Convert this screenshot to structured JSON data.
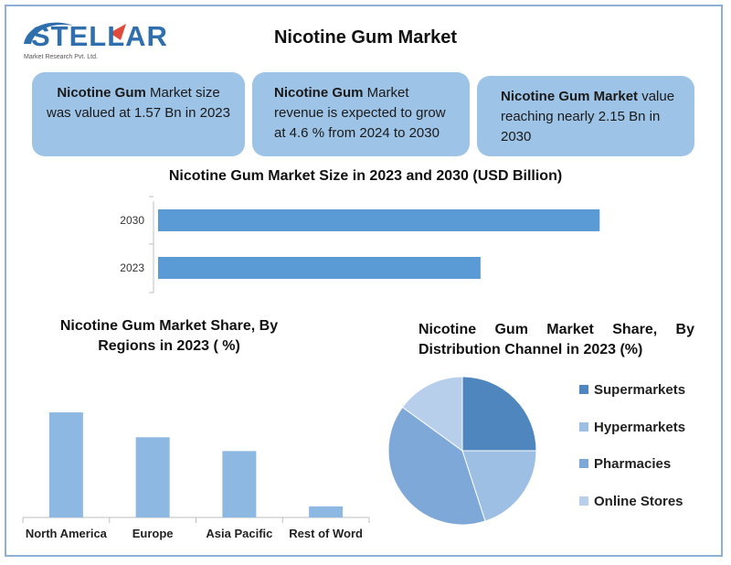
{
  "brand": {
    "name": "STELLAR",
    "subtitle": "Market Research Pvt. Ltd."
  },
  "title": "Nicotine Gum Market",
  "cards": [
    {
      "bold": "Nicotine Gum",
      "text": " Market size was valued at 1.57 Bn in 2023"
    },
    {
      "bold": "Nicotine Gum",
      "text": " Market revenue is expected to grow at 4.6 % from 2024 to 2030"
    },
    {
      "bold": "Nicotine Gum Market",
      "text": " value reaching nearly 2.15 Bn in 2030"
    }
  ],
  "colors": {
    "bar": "#5b9bd5",
    "card": "#9dc3e6",
    "region_bar": "#8db8e2",
    "pie": [
      "#4f86bd",
      "#9dbfe3",
      "#7ea8d8",
      "#b8cfeb"
    ]
  },
  "chart_data": [
    {
      "type": "bar",
      "orientation": "horizontal",
      "title": "Nicotine Gum Market Size in 2023 and 2030 (USD Billion)",
      "categories": [
        "2030",
        "2023"
      ],
      "values": [
        2.15,
        1.57
      ],
      "xlim": [
        0,
        2.3
      ],
      "grid": false
    },
    {
      "type": "bar",
      "title_line1": "Nicotine Gum Market Share, By",
      "title_line2": "Regions in 2023 ( %)",
      "categories": [
        "North America",
        "Europe",
        "Asia Pacific",
        "Rest of Word"
      ],
      "values": [
        38,
        29,
        24,
        4
      ],
      "ylim": [
        0,
        40
      ],
      "grid": false
    },
    {
      "type": "pie",
      "title_line1": "Nicotine Gum Market Share, By",
      "title_line2": "Distribution Channel in 2023 (%)",
      "labels": [
        "Supermarkets",
        "Hypermarkets",
        "Pharmacies",
        "Online Stores"
      ],
      "values": [
        25,
        20,
        40,
        15
      ],
      "legend": "right"
    }
  ]
}
